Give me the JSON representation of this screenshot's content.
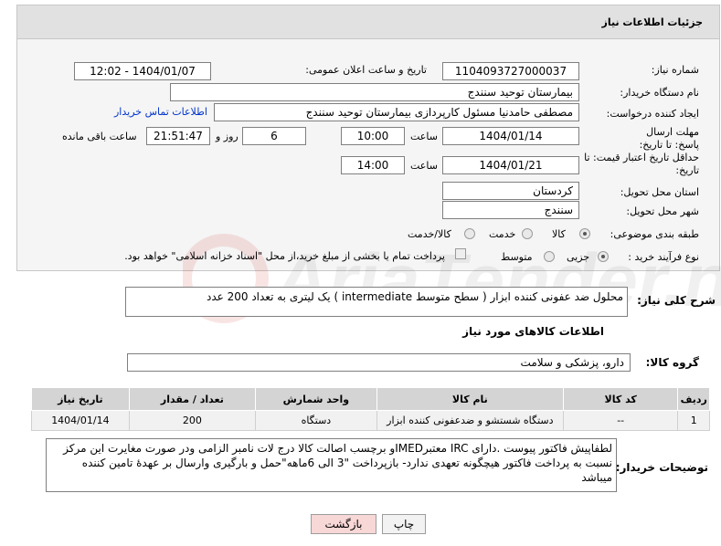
{
  "header": {
    "title": "جزئیات اطلاعات نیاز"
  },
  "need_number": {
    "label": "شماره نیاز:",
    "value": "1104093727000037"
  },
  "announce": {
    "label": "تاریخ و ساعت اعلان عمومی:",
    "value": "1404/01/07 - 12:02"
  },
  "buyer_org": {
    "label": "نام دستگاه خریدار:",
    "value": "بیمارستان توحید سنندج"
  },
  "creator": {
    "label": "ایجاد کننده درخواست:",
    "value": "مصطفی حامدنیا مسئول کارپردازی بیمارستان توحید سنندج",
    "contact_link": "اطلاعات تماس خریدار"
  },
  "reply_deadline": {
    "label": "مهلت ارسال پاسخ: تا تاریخ:",
    "date": "1404/01/14",
    "time_label": "ساعت",
    "time": "10:00",
    "days": "6",
    "days_label": "روز و",
    "remaining": "21:51:47",
    "remaining_label": "ساعت باقی مانده"
  },
  "price_validity": {
    "label": "حداقل تاریخ اعتبار قیمت: تا تاریخ:",
    "date": "1404/01/21",
    "time_label": "ساعت",
    "time": "14:00"
  },
  "province": {
    "label": "استان محل تحویل:",
    "value": "کردستان"
  },
  "city": {
    "label": "شهر محل تحویل:",
    "value": "سنندج"
  },
  "category": {
    "label": "طبقه بندی موضوعی:",
    "options": [
      "کالا",
      "خدمت",
      "کالا/خدمت"
    ],
    "selected": "کالا"
  },
  "process": {
    "label": "نوع فرآیند خرید :",
    "options": [
      "جزیی",
      "متوسط"
    ],
    "selected": "جزیی",
    "note": "پرداخت تمام یا بخشی از مبلغ خرید،از محل \"اسناد خزانه اسلامی\" خواهد بود."
  },
  "description": {
    "label": "شرح کلی نیاز:",
    "value": "محلول ضد عفونی کننده ابزار ( سطح متوسط intermediate ) یک لیتری به تعداد 200 عدد"
  },
  "goods_info": {
    "title": "اطلاعات کالاهای مورد نیاز"
  },
  "goods_group": {
    "label": "گروه کالا:",
    "value": "دارو، پزشکی و سلامت"
  },
  "table": {
    "headers": [
      "ردیف",
      "کد کالا",
      "نام کالا",
      "واحد شمارش",
      "تعداد / مقدار",
      "تاریخ نیاز"
    ],
    "rows": [
      [
        "1",
        "--",
        "دستگاه شستشو و ضدعفونی کننده ابزار",
        "دستگاه",
        "200",
        "1404/01/14"
      ]
    ]
  },
  "buyer_notes": {
    "label": "توضیحات خریدار:",
    "value": "لطفاپیش فاکتور پیوست .دارای IRC معتبرIMEDو برچسب اصالت کالا درج لات نامبر الزامی ودر صورت مغایرت این مرکز نسبت به پرداخت فاکتور هیچگونه تعهدی ندارد- بازپرداخت \"3 الی 6ماهه\"حمل و بارگیری وارسال بر عهدهٔ تامین کننده میباشد"
  },
  "buttons": {
    "print": "چاپ",
    "back": "بازگشت"
  },
  "watermark": {
    "text": "AriaTender.net"
  },
  "colors": {
    "link": "#0033cc",
    "back_button_bg": "#f8d7d7",
    "print_button_bg": "#f2f2f2"
  }
}
